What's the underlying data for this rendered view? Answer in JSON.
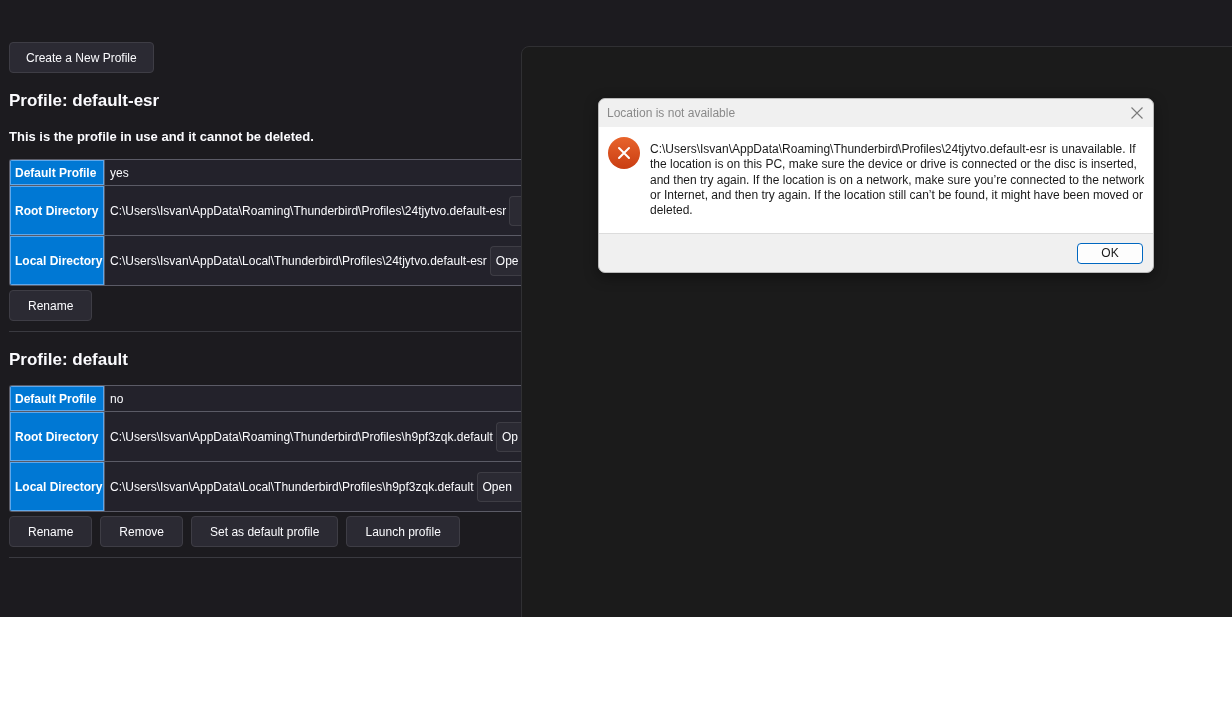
{
  "page": {
    "create_button": "Create a New Profile"
  },
  "profiles": [
    {
      "title": "Profile: default-esr",
      "note": "This is the profile in use and it cannot be deleted.",
      "rows": [
        {
          "kind": "text",
          "label": "Default Profile",
          "value": "yes"
        },
        {
          "kind": "path",
          "label": "Root Directory",
          "value": "C:\\Users\\Isvan\\AppData\\Roaming\\Thunderbird\\Profiles\\24tjytvo.default-esr",
          "button": {
            "cut": true
          }
        },
        {
          "kind": "path",
          "label": "Local Directory",
          "value": "C:\\Users\\Isvan\\AppData\\Local\\Thunderbird\\Profiles\\24tjytvo.default-esr",
          "button": {
            "label": "Ope",
            "cut": true
          }
        }
      ],
      "actions": [
        "Rename"
      ]
    },
    {
      "title": "Profile: default",
      "rows": [
        {
          "kind": "text",
          "label": "Default Profile",
          "value": "no"
        },
        {
          "kind": "path",
          "label": "Root Directory",
          "value": "C:\\Users\\Isvan\\AppData\\Roaming\\Thunderbird\\Profiles\\h9pf3zqk.default",
          "button": {
            "label": "Op",
            "cut": true
          }
        },
        {
          "kind": "path",
          "label": "Local Directory",
          "value": "C:\\Users\\Isvan\\AppData\\Local\\Thunderbird\\Profiles\\h9pf3zqk.default",
          "button": {
            "label": "Open",
            "cut": true
          }
        }
      ],
      "actions": [
        "Rename",
        "Remove",
        "Set as default profile",
        "Launch profile"
      ]
    }
  ],
  "dialog": {
    "title": "Location is not available",
    "message": "C:\\Users\\Isvan\\AppData\\Roaming\\Thunderbird\\Profiles\\24tjytvo.default-esr is unavailable. If the location is on this PC, make sure the device or drive is connected or the disc is inserted, and then try again. If the location is on a network, make sure you’re connected to the network or Internet, and then try again. If the location still can’t be found, it might have been moved or deleted.",
    "buttons": [
      {
        "label": "OK",
        "default": true
      }
    ]
  }
}
